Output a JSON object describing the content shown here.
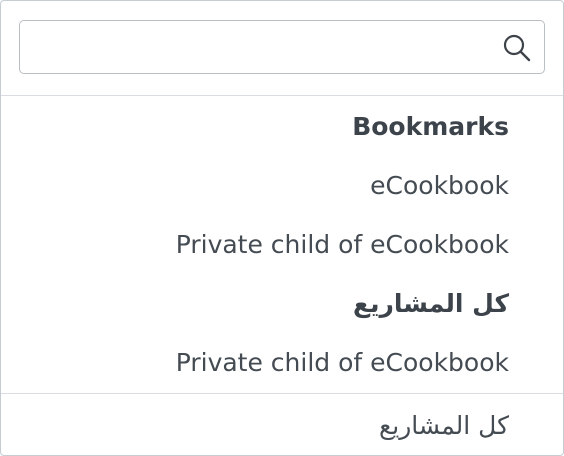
{
  "search": {
    "value": "",
    "placeholder": ""
  },
  "list": {
    "bookmarks_header": "Bookmarks",
    "bookmark_items": [
      "eCookbook",
      "Private child of eCookbook"
    ],
    "all_projects_header": "كل المشاريع",
    "project_items": [
      "Private child of eCookbook"
    ]
  },
  "footer": {
    "all_projects_link": "كل المشاريع"
  }
}
